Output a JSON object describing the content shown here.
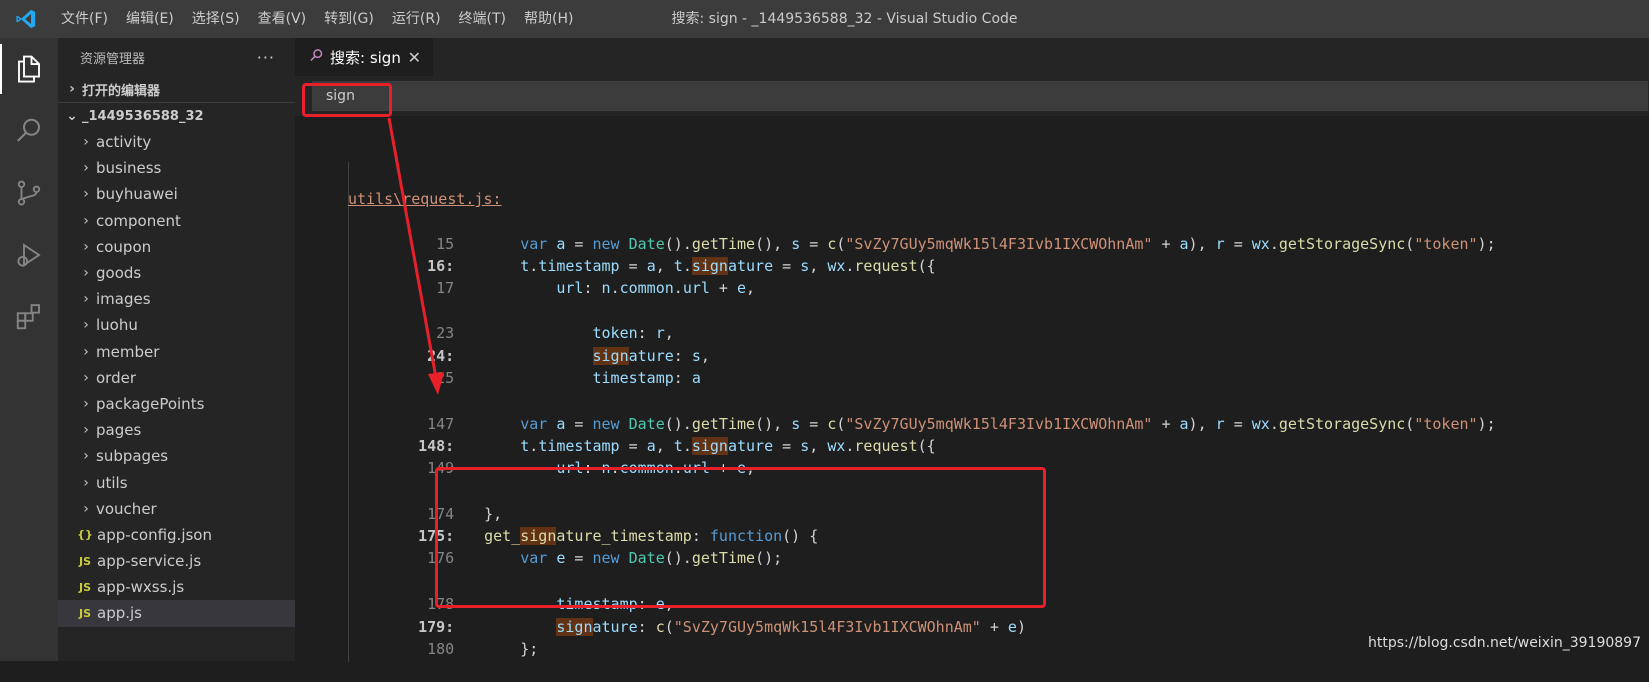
{
  "titlebar": {
    "menu": [
      "文件(F)",
      "编辑(E)",
      "选择(S)",
      "查看(V)",
      "转到(G)",
      "运行(R)",
      "终端(T)",
      "帮助(H)"
    ],
    "window_title": "搜索: sign - _1449536588_32 - Visual Studio Code"
  },
  "activity_bar": {
    "icons": [
      "explorer-icon",
      "search-icon",
      "source-control-icon",
      "run-debug-icon",
      "extensions-icon"
    ]
  },
  "sidebar": {
    "title": "资源管理器",
    "more": "···",
    "open_editors": "打开的编辑器",
    "project": "_1449536588_32",
    "folders": [
      "activity",
      "business",
      "buyhuawei",
      "component",
      "coupon",
      "goods",
      "images",
      "luohu",
      "member",
      "order",
      "packagePoints",
      "pages",
      "subpages",
      "utils",
      "voucher"
    ],
    "files": [
      {
        "icon": "{}",
        "name": "app-config.json",
        "type": "json"
      },
      {
        "icon": "JS",
        "name": "app-service.js",
        "type": "js"
      },
      {
        "icon": "JS",
        "name": "app-wxss.js",
        "type": "js"
      },
      {
        "icon": "JS",
        "name": "app.js",
        "type": "js"
      }
    ]
  },
  "editor": {
    "tab_label": "搜索: sign",
    "search_query": "sign",
    "file_heading": "utils\\request.js:",
    "lines": [
      {
        "n": "15",
        "hit": false
      },
      {
        "n": "16:",
        "hit": true
      },
      {
        "n": "17",
        "hit": false
      },
      {
        "n": "23",
        "hit": false
      },
      {
        "n": "24:",
        "hit": true
      },
      {
        "n": "25",
        "hit": false
      },
      {
        "n": "147",
        "hit": false
      },
      {
        "n": "148:",
        "hit": true
      },
      {
        "n": "149",
        "hit": false
      },
      {
        "n": "174",
        "hit": false
      },
      {
        "n": "175:",
        "hit": true
      },
      {
        "n": "176",
        "hit": false
      },
      {
        "n": "178",
        "hit": false
      },
      {
        "n": "179:",
        "hit": true
      },
      {
        "n": "180",
        "hit": false
      }
    ],
    "code_strings": {
      "key": "\"SvZy7GUy5mqWk15l4F3Ivb1IXCWOhnAm\"",
      "token": "\"token\""
    }
  },
  "watermark": "https://blog.csdn.net/weixin_39190897",
  "colors": {
    "annotation": "#e8202a",
    "match_highlight": "#613214",
    "accent": "#007acc"
  }
}
